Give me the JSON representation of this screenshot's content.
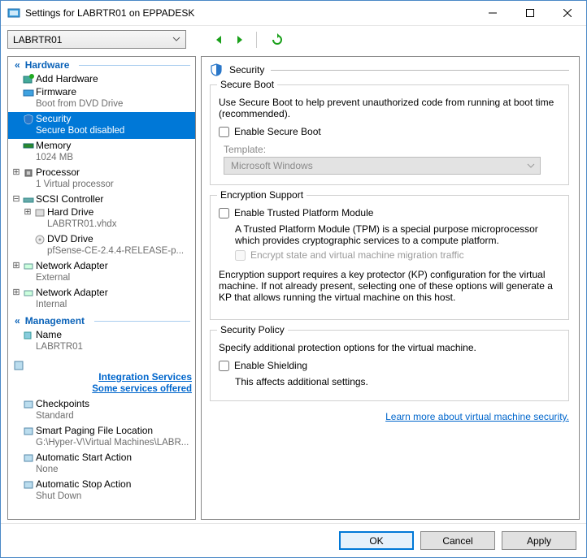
{
  "window": {
    "title": "Settings for LABRTR01 on EPPADESK"
  },
  "toolbar": {
    "vm_selected": "LABRTR01"
  },
  "tree": {
    "hardware_header": "Hardware",
    "management_header": "Management",
    "items": {
      "add_hardware": {
        "label": "Add Hardware"
      },
      "firmware": {
        "label": "Firmware",
        "sub": "Boot from DVD Drive"
      },
      "security": {
        "label": "Security",
        "sub": "Secure Boot disabled"
      },
      "memory": {
        "label": "Memory",
        "sub": "1024 MB"
      },
      "processor": {
        "label": "Processor",
        "sub": "1 Virtual processor"
      },
      "scsi": {
        "label": "SCSI Controller"
      },
      "hdd": {
        "label": "Hard Drive",
        "sub": "LABRTR01.vhdx"
      },
      "dvd": {
        "label": "DVD Drive",
        "sub": "pfSense-CE-2.4.4-RELEASE-p..."
      },
      "net1": {
        "label": "Network Adapter",
        "sub": "External"
      },
      "net2": {
        "label": "Network Adapter",
        "sub": "Internal"
      },
      "name": {
        "label": "Name",
        "sub": "LABRTR01"
      },
      "integration": {
        "label": "Integration Services",
        "sub": "Some services offered"
      },
      "checkpoints": {
        "label": "Checkpoints",
        "sub": "Standard"
      },
      "smartpaging": {
        "label": "Smart Paging File Location",
        "sub": "G:\\Hyper-V\\Virtual Machines\\LABR..."
      },
      "autostart": {
        "label": "Automatic Start Action",
        "sub": "None"
      },
      "autostop": {
        "label": "Automatic Stop Action",
        "sub": "Shut Down"
      }
    }
  },
  "content": {
    "header": "Security",
    "secure_boot": {
      "group_title": "Secure Boot",
      "desc": "Use Secure Boot to help prevent unauthorized code from running at boot time (recommended).",
      "checkbox_label": "Enable Secure Boot",
      "template_label": "Template:",
      "template_value": "Microsoft Windows"
    },
    "encryption": {
      "group_title": "Encryption Support",
      "tpm_label": "Enable Trusted Platform Module",
      "tpm_desc": "A Trusted Platform Module (TPM) is a special purpose microprocessor which provides cryptographic services to a compute platform.",
      "migrate_label": "Encrypt state and virtual machine migration traffic",
      "kp_desc": "Encryption support requires a key protector (KP) configuration for the virtual machine. If not already present, selecting one of these options will generate a KP that allows running the virtual machine on this host."
    },
    "policy": {
      "group_title": "Security Policy",
      "desc": "Specify additional protection options for the virtual machine.",
      "checkbox_label": "Enable Shielding",
      "note": "This affects additional settings."
    },
    "learn_more": "Learn more about virtual machine security."
  },
  "footer": {
    "ok": "OK",
    "cancel": "Cancel",
    "apply": "Apply"
  }
}
